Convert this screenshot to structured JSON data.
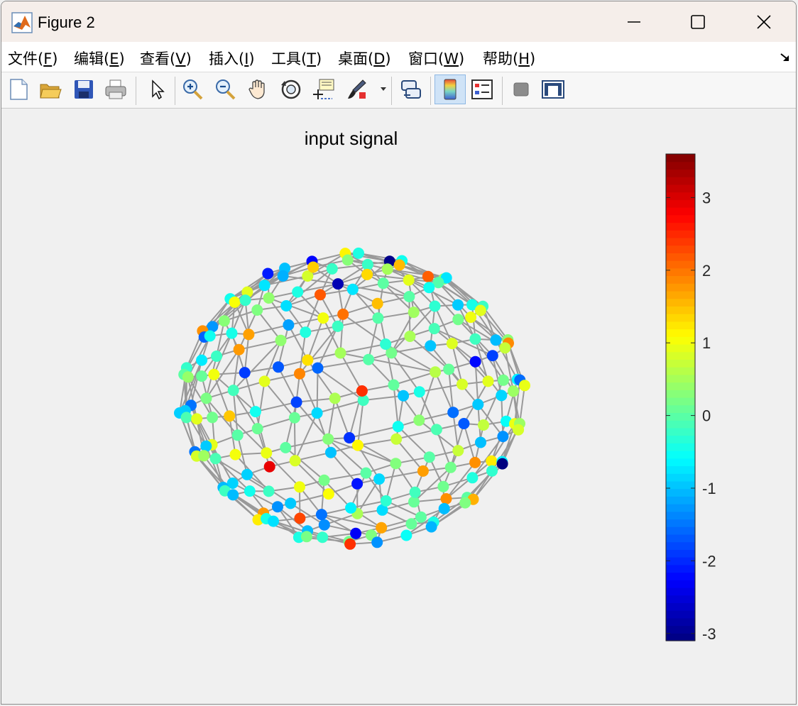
{
  "window": {
    "title": "Figure 2"
  },
  "menu": {
    "items": [
      {
        "label": "文件(",
        "key": "F",
        "end": ")"
      },
      {
        "label": "编辑(",
        "key": "E",
        "end": ")"
      },
      {
        "label": "查看(",
        "key": "V",
        "end": ")"
      },
      {
        "label": "插入(",
        "key": "I",
        "end": ")"
      },
      {
        "label": "工具(",
        "key": "T",
        "end": ")"
      },
      {
        "label": "桌面(",
        "key": "D",
        "end": ")"
      },
      {
        "label": "窗口(",
        "key": "W",
        "end": ")"
      },
      {
        "label": "帮助(",
        "key": "H",
        "end": ")"
      }
    ]
  },
  "toolbar": {
    "icons": [
      "new-file-icon",
      "open-folder-icon",
      "save-icon",
      "print-icon",
      "pointer-icon",
      "zoom-in-icon",
      "zoom-out-icon",
      "pan-hand-icon",
      "rotate-3d-icon",
      "data-cursor-icon",
      "brush-icon",
      "brush-dropdown-icon",
      "link-plot-icon",
      "colorbar-icon",
      "legend-icon",
      "hide-plot-tools-icon",
      "show-plot-tools-icon"
    ],
    "active": "colorbar-icon"
  },
  "figure": {
    "title": "input signal"
  },
  "colorbar": {
    "colormap": "jet",
    "limits": [
      -3.1,
      3.6
    ],
    "ticks": [
      {
        "value": 3,
        "label": "3"
      },
      {
        "value": 2,
        "label": "2"
      },
      {
        "value": 1,
        "label": "1"
      },
      {
        "value": 0,
        "label": "0"
      },
      {
        "value": -1,
        "label": "-1"
      },
      {
        "value": -2,
        "label": "-2"
      },
      {
        "value": -3,
        "label": "-3"
      }
    ]
  },
  "colors": {
    "edge": "#999999",
    "window_bg": "#f0f0f0",
    "titlebar_bg": "#f5eeea"
  }
}
